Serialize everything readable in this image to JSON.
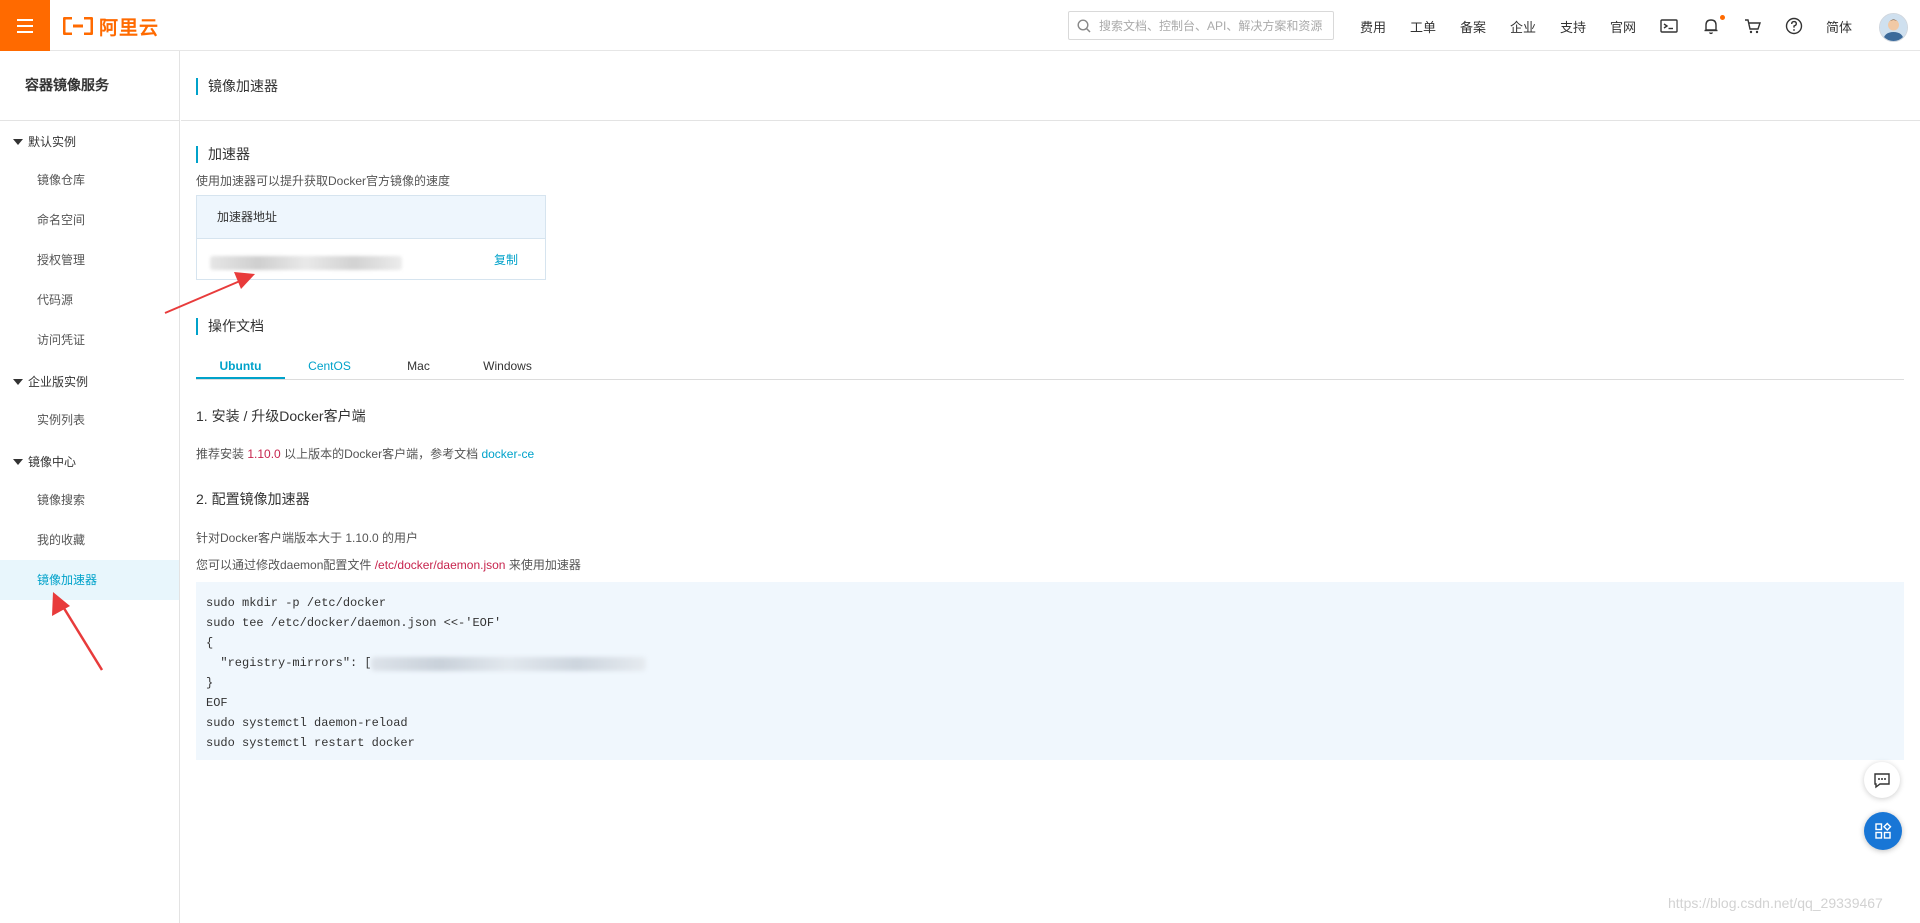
{
  "topbar": {
    "logo_text": "阿里云",
    "search_placeholder": "搜索文档、控制台、API、解决方案和资源",
    "nav": [
      "费用",
      "工单",
      "备案",
      "企业",
      "支持",
      "官网"
    ],
    "lang": "简体",
    "icons": [
      "terminal-icon",
      "bell-icon",
      "cart-icon",
      "help-icon"
    ],
    "accent": "#ff6a00"
  },
  "sidebar": {
    "title": "容器镜像服务",
    "groups": [
      {
        "label": "默认实例",
        "items": [
          "镜像仓库",
          "命名空间",
          "授权管理",
          "代码源",
          "访问凭证"
        ]
      },
      {
        "label": "企业版实例",
        "items": [
          "实例列表"
        ]
      },
      {
        "label": "镜像中心",
        "items": [
          "镜像搜索",
          "我的收藏",
          "镜像加速器"
        ]
      }
    ],
    "active_item": "镜像加速器"
  },
  "main": {
    "page_title": "镜像加速器",
    "accelerator": {
      "title": "加速器",
      "desc": "使用加速器可以提升获取Docker官方镜像的速度",
      "table_header": "加速器地址",
      "copy": "复制"
    },
    "docs": {
      "title": "操作文档",
      "tabs": [
        "Ubuntu",
        "CentOS",
        "Mac",
        "Windows"
      ],
      "active_tab": "Ubuntu",
      "step1": {
        "title": "1. 安装 / 升级Docker客户端",
        "text_before": "推荐安装",
        "version": "1.10.0",
        "text_after": "以上版本的Docker客户端，参考文档",
        "link": "docker-ce"
      },
      "step2": {
        "title": "2. 配置镜像加速器",
        "line1": "针对Docker客户端版本大于 1.10.0 的用户",
        "line2_before": "您可以通过修改daemon配置文件",
        "line2_path": "/etc/docker/daemon.json",
        "line2_after": "来使用加速器"
      },
      "code_lines": [
        "sudo mkdir -p /etc/docker",
        "sudo tee /etc/docker/daemon.json <<-'EOF'",
        "{",
        "  \"registry-mirrors\": [",
        "}",
        "EOF",
        "sudo systemctl daemon-reload",
        "sudo systemctl restart docker"
      ]
    }
  },
  "watermark": "https://blog.csdn.net/qq_29339467"
}
